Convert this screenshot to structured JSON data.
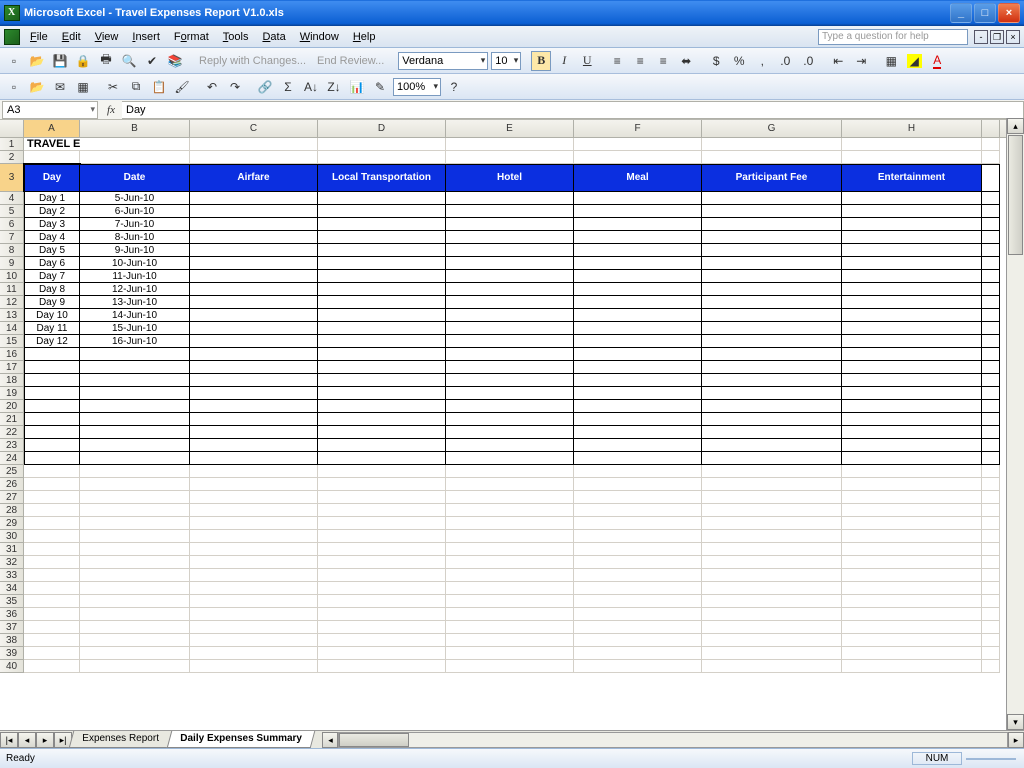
{
  "window": {
    "title": "Microsoft Excel - Travel Expenses Report V1.0.xls"
  },
  "menu": {
    "file": "File",
    "edit": "Edit",
    "view": "View",
    "insert": "Insert",
    "format": "Format",
    "tools": "Tools",
    "data": "Data",
    "window": "Window",
    "help": "Help",
    "helpbox": "Type a question for help"
  },
  "toolbar": {
    "font": "Verdana",
    "size": "10",
    "zoom": "100%",
    "reply": "Reply with Changes...",
    "end": "End Review..."
  },
  "formula": {
    "name": "A3",
    "fx": "fx",
    "value": "Day"
  },
  "cols": [
    "A",
    "B",
    "C",
    "D",
    "E",
    "F",
    "G",
    "H"
  ],
  "sheet": {
    "title": "TRAVEL EXPENSES DAILY DETAIL",
    "headers": [
      "Day",
      "Date",
      "Airfare",
      "Local Transportation",
      "Hotel",
      "Meal",
      "Participant Fee",
      "Entertainment"
    ],
    "rows": [
      {
        "day": "Day 1",
        "date": "5-Jun-10"
      },
      {
        "day": "Day 2",
        "date": "6-Jun-10"
      },
      {
        "day": "Day 3",
        "date": "7-Jun-10"
      },
      {
        "day": "Day 4",
        "date": "8-Jun-10"
      },
      {
        "day": "Day 5",
        "date": "9-Jun-10"
      },
      {
        "day": "Day 6",
        "date": "10-Jun-10"
      },
      {
        "day": "Day 7",
        "date": "11-Jun-10"
      },
      {
        "day": "Day 8",
        "date": "12-Jun-10"
      },
      {
        "day": "Day 9",
        "date": "13-Jun-10"
      },
      {
        "day": "Day 10",
        "date": "14-Jun-10"
      },
      {
        "day": "Day 11",
        "date": "15-Jun-10"
      },
      {
        "day": "Day 12",
        "date": "16-Jun-10"
      }
    ]
  },
  "tabs": {
    "t1": "Expenses Report",
    "t2": "Daily Expenses Summary"
  },
  "status": {
    "ready": "Ready",
    "num": "NUM"
  }
}
